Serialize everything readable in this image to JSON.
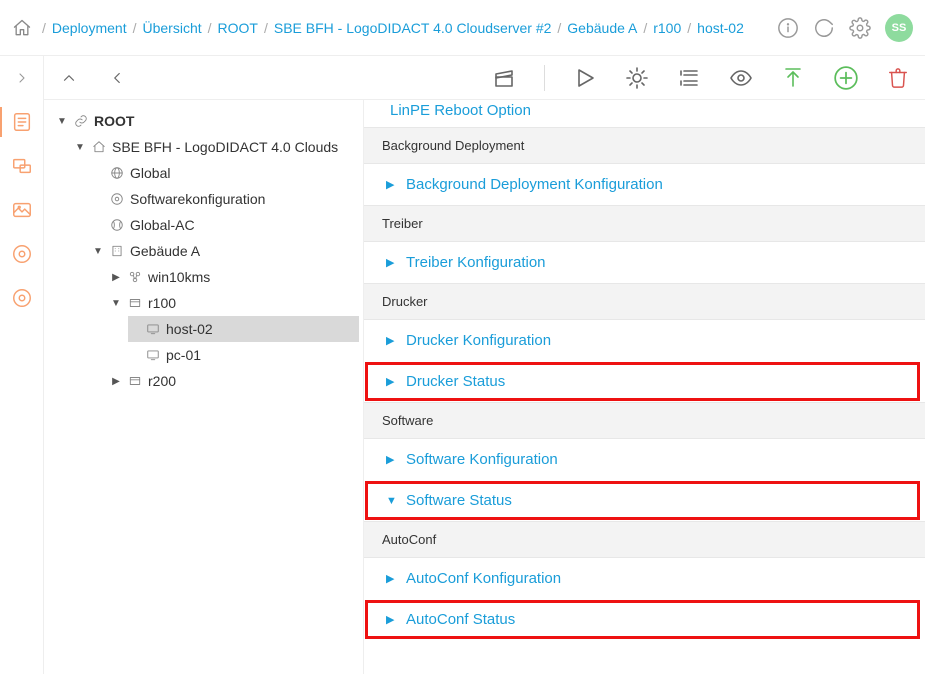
{
  "avatar": "SS",
  "breadcrumbs": [
    "Deployment",
    "Übersicht",
    "ROOT",
    "SBE BFH - LogoDIDACT 4.0 Cloudserver #2",
    "Gebäude A",
    "r100",
    "host-02"
  ],
  "tree": {
    "root": "ROOT",
    "server": "SBE BFH - LogoDIDACT 4.0 Clouds",
    "global": "Global",
    "softwarekonfig": "Softwarekonfiguration",
    "globalac": "Global-AC",
    "building": "Gebäude A",
    "win10kms": "win10kms",
    "r100": "r100",
    "host02": "host-02",
    "pc01": "pc-01",
    "r200": "r200"
  },
  "content": {
    "partial_top": "LinPE Reboot Option",
    "sections": [
      {
        "header": "Background Deployment",
        "items": [
          {
            "label": "Background Deployment Konfiguration",
            "open": false,
            "hl": false
          }
        ]
      },
      {
        "header": "Treiber",
        "items": [
          {
            "label": "Treiber Konfiguration",
            "open": false,
            "hl": false
          }
        ]
      },
      {
        "header": "Drucker",
        "items": [
          {
            "label": "Drucker Konfiguration",
            "open": false,
            "hl": false
          },
          {
            "label": "Drucker Status",
            "open": false,
            "hl": true
          }
        ]
      },
      {
        "header": "Software",
        "items": [
          {
            "label": "Software Konfiguration",
            "open": false,
            "hl": false
          },
          {
            "label": "Software Status",
            "open": true,
            "hl": true
          }
        ]
      },
      {
        "header": "AutoConf",
        "items": [
          {
            "label": "AutoConf Konfiguration",
            "open": false,
            "hl": false
          },
          {
            "label": "AutoConf Status",
            "open": false,
            "hl": true
          }
        ]
      }
    ]
  }
}
